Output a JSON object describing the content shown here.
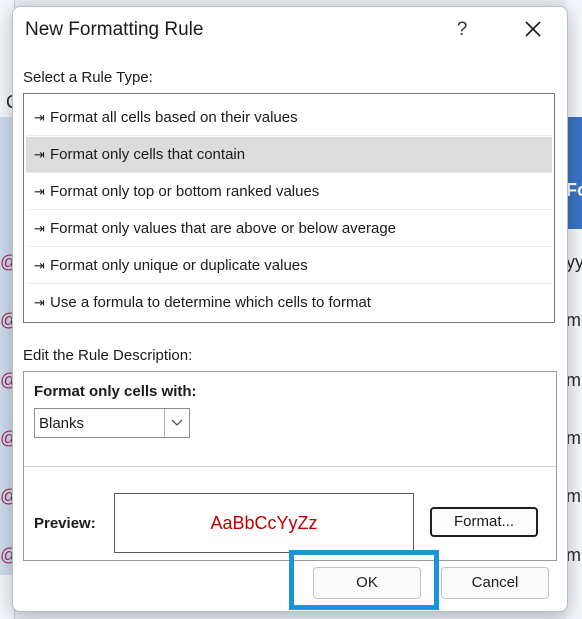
{
  "dialog": {
    "title": "New Formatting Rule",
    "help_label": "?",
    "rule_type_label": "Select a Rule Type:",
    "rule_types": [
      {
        "label": "Format all cells based on their values",
        "selected": false
      },
      {
        "label": "Format only cells that contain",
        "selected": true
      },
      {
        "label": "Format only top or bottom ranked values",
        "selected": false
      },
      {
        "label": "Format only values that are above or below average",
        "selected": false
      },
      {
        "label": "Format only unique or duplicate values",
        "selected": false
      },
      {
        "label": "Use a formula to determine which cells to format",
        "selected": false
      }
    ],
    "rule_arrow_glyph": "⇥",
    "description_label": "Edit the Rule Description:",
    "description": {
      "heading": "Format only cells with:",
      "condition_value": "Blanks",
      "preview_label": "Preview:",
      "preview_text": "AaBbCcYyZz",
      "preview_color": "#c00000",
      "format_button": "Format..."
    },
    "ok_button": "OK",
    "cancel_button": "Cancel",
    "highlight_color": "#1a95d8"
  },
  "background": {
    "fragments": [
      "C",
      "Fo",
      "@",
      "yy",
      "@",
      "m",
      "@",
      "m",
      "@",
      "m",
      "@",
      "m",
      "@",
      "m"
    ]
  }
}
